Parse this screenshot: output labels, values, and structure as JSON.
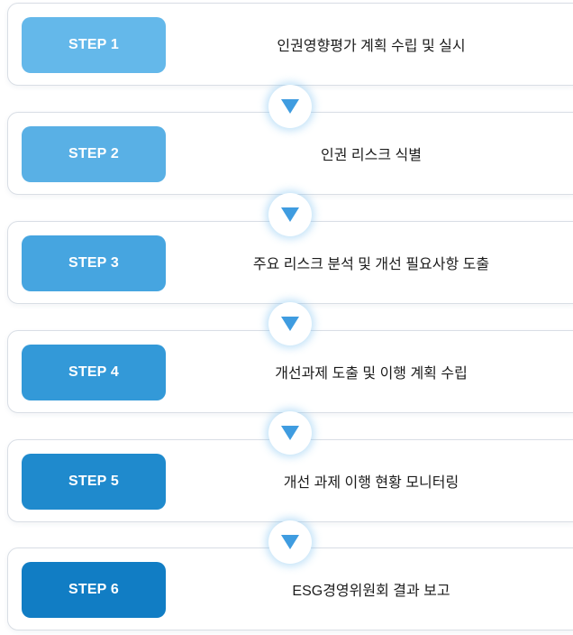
{
  "steps": [
    {
      "label": "STEP 1",
      "text": "인권영향평가 계획 수립 및 실시",
      "color": "#64b8ea"
    },
    {
      "label": "STEP 2",
      "text": "인권 리스크 식별",
      "color": "#59b0e5"
    },
    {
      "label": "STEP 3",
      "text": "주요 리스크 분석 및 개선 필요사항 도출",
      "color": "#46a5e0"
    },
    {
      "label": "STEP 4",
      "text": "개선과제 도출 및 이행 계획 수립",
      "color": "#3399d8"
    },
    {
      "label": "STEP 5",
      "text": "개선 과제 이행 현황 모니터링",
      "color": "#1f8acd"
    },
    {
      "label": "STEP 6",
      "text": "ESG경영위원회 결과 보고",
      "color": "#117dc4"
    }
  ],
  "connector_color": "#3f9ce0",
  "connector_icon": "triangle-down-icon"
}
